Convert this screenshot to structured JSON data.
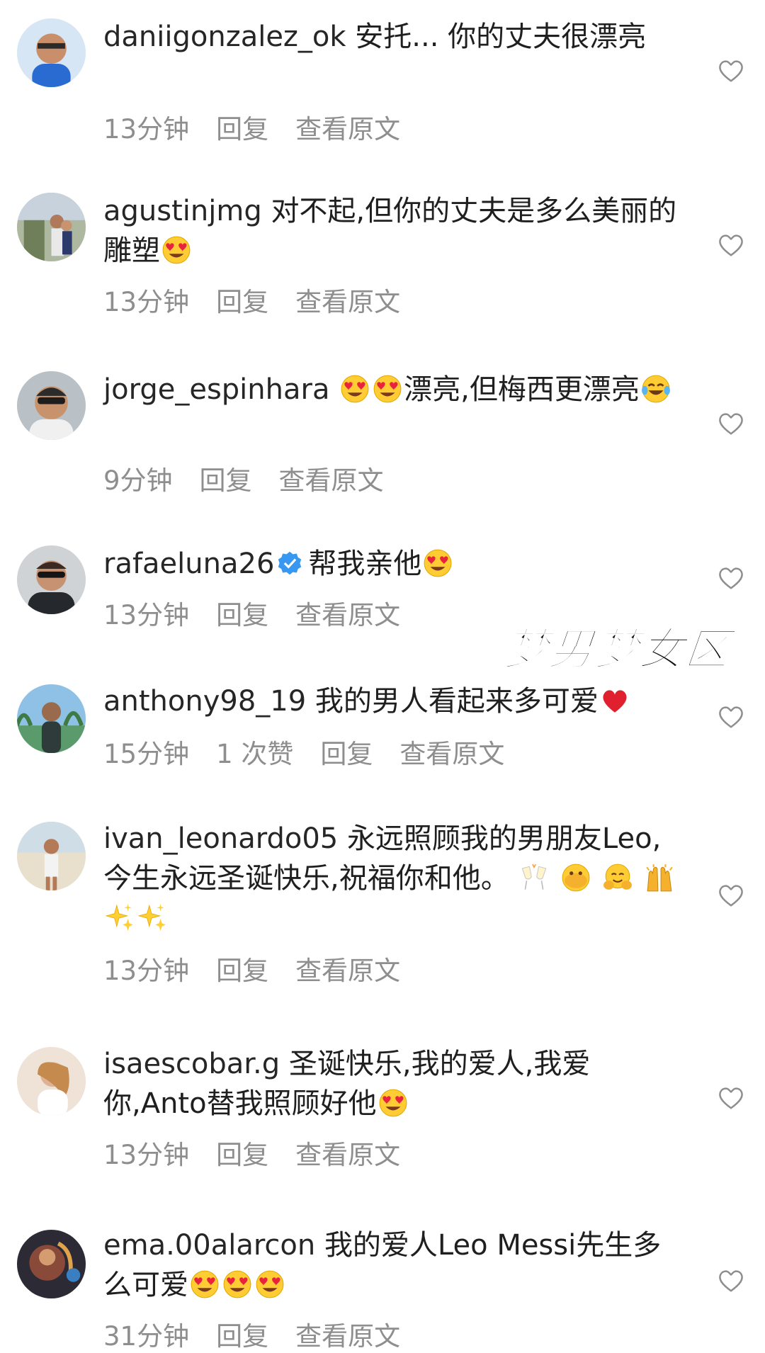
{
  "comments": [
    {
      "username": "daniigonzalez_ok",
      "text": "安托... 你的丈夫很漂亮",
      "emojis": [],
      "time": "13分钟",
      "likes": "",
      "reply": "回复",
      "translate": "查看原文",
      "avatar_color": "#2a6bd1"
    },
    {
      "username": "agustinjmg",
      "text": "对不起,但你的丈夫是多么美丽的雕塑",
      "emojis": [
        "heart-eyes-emoji"
      ],
      "time": "13分钟",
      "likes": "",
      "reply": "回复",
      "translate": "查看原文",
      "avatar_color": "#6f7f5a"
    },
    {
      "username": "jorge_espinhara",
      "text": "漂亮,但梅西更漂亮",
      "emojis": [
        "heart-eyes-emoji",
        "heart-eyes-emoji",
        "laughing-tears-emoji"
      ],
      "time": "9分钟",
      "likes": "",
      "reply": "回复",
      "translate": "查看原文",
      "avatar_color": "#9aa3ac"
    },
    {
      "username": "rafaeluna26",
      "text": "帮我亲他",
      "emojis": [
        "heart-eyes-emoji"
      ],
      "verified": true,
      "time": "13分钟",
      "likes": "",
      "reply": "回复",
      "translate": "查看原文",
      "avatar_color": "#3b3f44"
    },
    {
      "username": "anthony98_19",
      "text": "我的男人看起来多可爱",
      "emojis": [
        "red-heart-emoji"
      ],
      "time": "15分钟",
      "likes": "1 次赞",
      "reply": "回复",
      "translate": "查看原文",
      "avatar_color": "#4f8f6a"
    },
    {
      "username": "ivan_leonardo05",
      "text": "永远照顾我的男朋友Leo,今生永远圣诞快乐,祝福你和他。",
      "emojis": [
        "clinking-glasses-emoji",
        "face-peeking-emoji",
        "hugging-emoji",
        "raising-hands-emoji",
        "sparkles-emoji",
        "sparkles-emoji"
      ],
      "time": "13分钟",
      "likes": "",
      "reply": "回复",
      "translate": "查看原文",
      "avatar_color": "#c9b99a"
    },
    {
      "username": "isaescobar.g",
      "text": "圣诞快乐,我的爱人,我爱你,Anto替我照顾好他",
      "emojis": [
        "heart-eyes-emoji"
      ],
      "time": "13分钟",
      "likes": "",
      "reply": "回复",
      "translate": "查看原文",
      "avatar_color": "#d9b7a4"
    },
    {
      "username": "ema.00alarcon",
      "text": "我的爱人Leo Messi先生多么可爱",
      "emojis": [
        "heart-eyes-emoji",
        "heart-eyes-emoji",
        "heart-eyes-emoji"
      ],
      "time": "31分钟",
      "likes": "",
      "reply": "回复",
      "translate": "查看原文",
      "avatar_color": "#8a4a3a"
    }
  ],
  "watermark": "梦男梦女区"
}
